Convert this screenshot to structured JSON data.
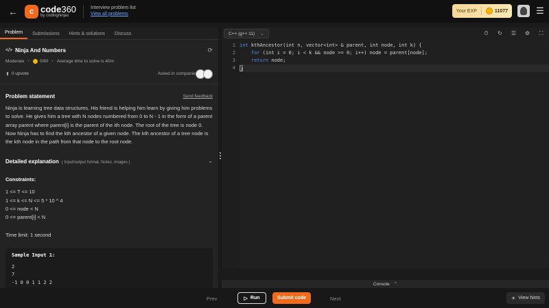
{
  "header": {
    "logo_badge": "c",
    "logo_main": "code",
    "logo_num": "360",
    "logo_sub": "by codingninjas",
    "crumb_title": "Interview problem list",
    "crumb_link": "View all problems",
    "exp_label": "Your EXP",
    "exp_value": "11077"
  },
  "left": {
    "tabs": [
      {
        "label": "Problem"
      },
      {
        "label": "Submissions"
      },
      {
        "label": "Hints & solutions"
      },
      {
        "label": "Discuss"
      }
    ],
    "title": "Ninja And Numbers",
    "difficulty": "Moderate",
    "score": "0/80",
    "avg_time": "Average time to solve is 40m",
    "upvotes": "0 upvote",
    "asked_in": "Asked in companies",
    "statement_heading": "Problem statement",
    "send_feedback": "Send feedback",
    "statement": "Ninja is learning tree data structures. His friend is helping him learn by giving him problems to solve. He gives him a tree with N nodes numbered from 0 to N - 1 in the form of a parent array parent where parent[i] is the parent of the ith node. The root of the tree is node 0. Now Ninja has to find the kth ancestor of a given node. The kth ancestor of a tree node is the kth node in the path from that node to the root node.",
    "detailed_heading": "Detailed explanation",
    "detailed_sub": "( Input/output format, Notes, Images )",
    "constraints_heading": "Constraints:",
    "constraints": [
      "1 <= T <= 10",
      "1 <= k <= N <= 5 * 10 ^ 4",
      "0 <= node < N",
      "0 <= parent[i] < N"
    ],
    "time_limit": "Time limit: 1 second",
    "sample_heading": "Sample Input 1:",
    "sample_lines": [
      "2",
      "7",
      "-1 0 0 1 1 2 2"
    ]
  },
  "editor": {
    "language": "C++ (g++ 11)",
    "line_numbers": [
      "1",
      "2",
      "3",
      "4"
    ],
    "code_lines": [
      {
        "kw": "int",
        "rest": " kthAncestor(int n, vector<int> & parent, int node, int k) {"
      },
      {
        "kw": "    for",
        "rest": " (int i = 0; i < k && node >= 0; i++) node = parent[node];"
      },
      {
        "kw": "    return",
        "rest": " node;"
      },
      {
        "kw": "",
        "rest": "}"
      }
    ],
    "console_label": "Console"
  },
  "footer": {
    "prev": "Prev",
    "run": "Run",
    "submit": "Submit code",
    "next": "Next",
    "hints": "View hints"
  }
}
